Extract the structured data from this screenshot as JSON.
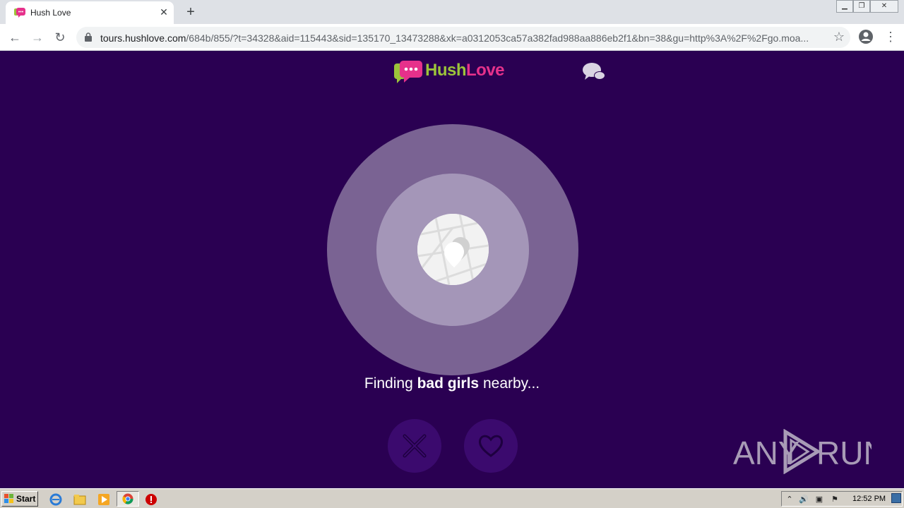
{
  "browser": {
    "tab_title": "Hush Love",
    "url_host": "tours.hushlove.com",
    "url_path": "/684b/855/?t=34328&aid=115443&sid=135170_13473288&xk=a0312053ca57a382fad988aa886eb2f1&bn=38&gu=http%3A%2F%2Fgo.moa..."
  },
  "page": {
    "logo_hush": "Hush",
    "logo_love": "Love",
    "finding_prefix": "Finding ",
    "finding_bold": "bad girls",
    "finding_suffix": " nearby..."
  },
  "watermark": {
    "text_left": "ANY",
    "text_right": "RUN"
  },
  "taskbar": {
    "start_label": "Start",
    "time": "12:52 PM"
  },
  "colors": {
    "background": "#2a0052",
    "radar_outer": "#7a6393",
    "radar_mid": "#a496b8",
    "logo_green": "#9cc43a",
    "logo_pink": "#e6318b"
  },
  "icons": [
    "hushlove-favicon",
    "close-icon",
    "plus-icon",
    "back-arrow-icon",
    "forward-arrow-icon",
    "reload-icon",
    "lock-icon",
    "star-icon",
    "profile-icon",
    "kebab-menu-icon",
    "chat-bubbles-icon",
    "map-pin-icon",
    "x-icon",
    "heart-icon",
    "anyrun-play-icon",
    "windows-flag-icon",
    "ie-icon",
    "folder-icon",
    "media-player-icon",
    "chrome-icon",
    "stop-icon"
  ]
}
